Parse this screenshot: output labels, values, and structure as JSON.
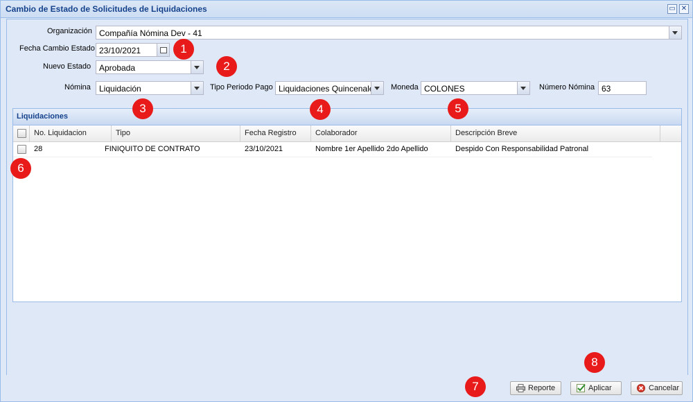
{
  "window": {
    "title": "Cambio de Estado de Solicitudes de Liquidaciones"
  },
  "form": {
    "organizacion_label": "Organización",
    "organizacion_value": "Compañía Nómina Dev - 41",
    "fecha_label": "Fecha Cambio Estado",
    "fecha_value": "23/10/2021",
    "nuevo_estado_label": "Nuevo Estado",
    "nuevo_estado_value": "Aprobada",
    "nomina_label": "Nómina",
    "nomina_value": "Liquidación",
    "tipo_periodo_label": "Tipo Periodo Pago",
    "tipo_periodo_value": "Liquidaciones Quincenales",
    "moneda_label": "Moneda",
    "moneda_value": "COLONES",
    "numero_nomina_label": "Número Nómina",
    "numero_nomina_value": "63"
  },
  "grid": {
    "title": "Liquidaciones",
    "columns": [
      "No. Liquidacion",
      "Tipo",
      "Fecha Registro",
      "Colaborador",
      "Descripción Breve"
    ],
    "rows": [
      {
        "no": "28",
        "tipo": "FINIQUITO DE CONTRATO",
        "fecha": "23/10/2021",
        "colaborador": "Nombre 1er Apellido 2do Apellido",
        "descripcion": "Despido Con Responsabilidad Patronal"
      }
    ]
  },
  "buttons": {
    "reporte": "Reporte",
    "aplicar": "Aplicar",
    "cancelar": "Cancelar"
  },
  "badges": [
    "1",
    "2",
    "3",
    "4",
    "5",
    "6",
    "7",
    "8"
  ],
  "colors": {
    "badge": "#e81a1a",
    "title": "#15428b",
    "panel": "#dfe8f6"
  }
}
